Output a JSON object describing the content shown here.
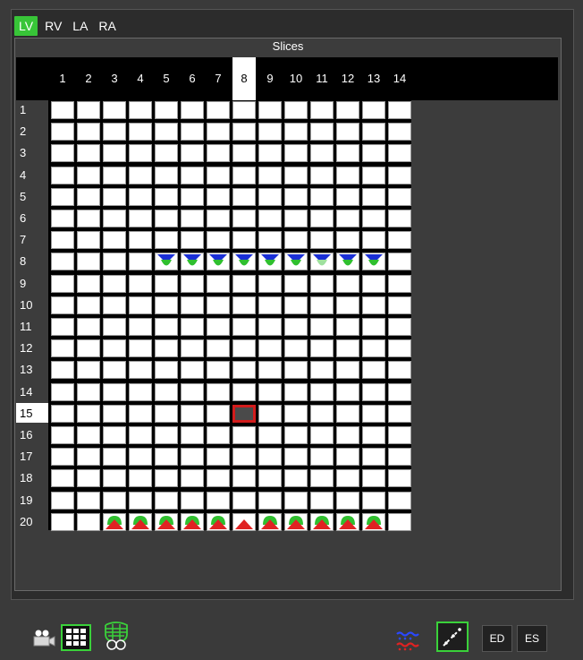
{
  "tabs": [
    {
      "label": "LV",
      "active": true
    },
    {
      "label": "RV",
      "active": false
    },
    {
      "label": "LA",
      "active": false
    },
    {
      "label": "RA",
      "active": false
    }
  ],
  "slices_title": "Slices",
  "columns": [
    "1",
    "2",
    "3",
    "4",
    "5",
    "6",
    "7",
    "8",
    "9",
    "10",
    "11",
    "12",
    "13",
    "14"
  ],
  "selected_column": "8",
  "rows": [
    "1",
    "2",
    "3",
    "4",
    "5",
    "6",
    "7",
    "8",
    "9",
    "10",
    "11",
    "12",
    "13",
    "14",
    "15",
    "16",
    "17",
    "18",
    "19",
    "20"
  ],
  "selected_row": "15",
  "markers": {
    "row_8": {
      "columns": [
        "5",
        "6",
        "7",
        "8",
        "9",
        "10",
        "11",
        "12",
        "13"
      ],
      "type": "blue-green-down"
    },
    "row_20": {
      "columns": [
        "3",
        "4",
        "5",
        "6",
        "7",
        "8",
        "9",
        "10",
        "11",
        "12",
        "13"
      ],
      "type": "green-red-up",
      "red_only": [
        "8"
      ]
    }
  },
  "toolbar": {
    "camera_icon": "movie-camera-icon",
    "grid_icon": "grid-view-icon",
    "heart_icon": "heart-contour-icon",
    "legend_icon": "blue-red-legend-icon",
    "curve_icon": "volume-curve-icon",
    "ed_label": "ED",
    "es_label": "ES"
  },
  "colors": {
    "active_tab": "#38c538",
    "selected_cell": "#d21c1c",
    "marker_blue": "#1a2fd6",
    "marker_green": "#2fbf2f",
    "marker_red": "#e02222"
  }
}
